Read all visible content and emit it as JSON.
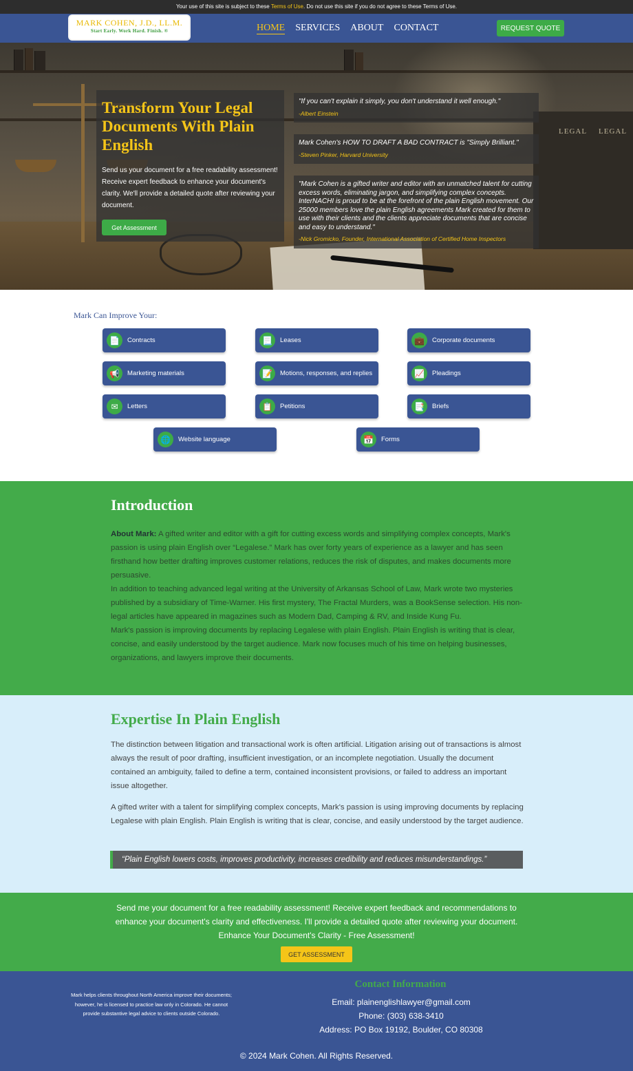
{
  "notice": {
    "before": "Your use of this site is subject to these ",
    "link": "Terms of Use",
    "after": ". Do not use this site if you do not agree to these Terms of Use."
  },
  "nav": {
    "logo_main": "MARK COHEN, J.D., LL.M.",
    "logo_tagline": "Start Early. Work Hard. Finish. ®",
    "links": [
      "HOME",
      "SERVICES",
      "ABOUT",
      "CONTACT"
    ],
    "active": "HOME",
    "quote_button": "REQUEST QUOTE"
  },
  "hero": {
    "title": "Transform Your Legal Documents With Plain English",
    "text": "Send us your document for a free readability assessment! Receive expert feedback to enhance your document's clarity. We'll provide a detailed quote after reviewing your document.",
    "button": "Get Assessment",
    "book_label": "LEGAL",
    "quotes": [
      {
        "text": "\"If you can't explain it simply, you don't understand it well enough.\"",
        "author": "-Albert Einstein"
      },
      {
        "text": "Mark Cohen's HOW TO DRAFT A BAD CONTRACT is \"Simply Brilliant.\"",
        "author": "-Steven Pinker, Harvard University"
      },
      {
        "text": "\"Mark Cohen is a gifted writer and editor with an unmatched talent for cutting excess words, eliminating jargon, and simplifying complex concepts. InterNACHI is proud to be at the forefront of the plain English movement. Our 25000 members love the plain English agreements Mark created for them to use with their clients and the clients appreciate documents that are concise and easy to understand.\"",
        "author": "-Nick Gromicko, Founder, International Association of Certified Home Inspectors"
      }
    ]
  },
  "services": {
    "title": "Mark Can Improve Your:",
    "items": [
      {
        "label": "Contracts",
        "icon": "document-icon",
        "glyph": "📄"
      },
      {
        "label": "Leases",
        "icon": "lease-icon",
        "glyph": "📃"
      },
      {
        "label": "Corporate documents",
        "icon": "briefcase-icon",
        "glyph": "💼"
      },
      {
        "label": "Marketing materials",
        "icon": "megaphone-icon",
        "glyph": "📢"
      },
      {
        "label": "Motions, responses, and replies",
        "icon": "memo-icon",
        "glyph": "📝"
      },
      {
        "label": "Pleadings",
        "icon": "chart-icon",
        "glyph": "📈"
      },
      {
        "label": "Letters",
        "icon": "envelope-icon",
        "glyph": "✉"
      },
      {
        "label": "Petitions",
        "icon": "petition-icon",
        "glyph": "📋"
      },
      {
        "label": "Briefs",
        "icon": "brief-icon",
        "glyph": "📑"
      },
      {
        "label": "Website language",
        "icon": "globe-icon",
        "glyph": "🌐"
      },
      {
        "label": "Forms",
        "icon": "calendar-icon",
        "glyph": "📅"
      }
    ]
  },
  "intro": {
    "title": "Introduction",
    "lead": "About Mark:",
    "p1": " A gifted writer and editor with a gift for cutting excess words and simplifying complex concepts, Mark's passion is using plain English over “Legalese.” Mark has over forty years of experience as a lawyer and has seen firsthand how better drafting improves customer relations, reduces the risk of disputes, and makes documents more persuasive.",
    "p2": "In addition to teaching advanced legal writing at the University of Arkansas School of Law, Mark wrote two mysteries published by a subsidiary of Time-Warner. His first mystery, The Fractal Murders, was a BookSense selection. His non-legal articles have appeared in magazines such as Modern Dad, Camping & RV, and Inside Kung Fu.",
    "p3": "Mark's passion is improving documents by replacing Legalese with plain English. Plain English is writing that is clear, concise, and easily understood by the target audience. Mark now focuses much of his time on helping businesses, organizations, and lawyers improve their documents."
  },
  "expertise": {
    "title": "Expertise In Plain English",
    "p1": "The distinction between litigation and transactional work is often artificial. Litigation arising out of transactions is almost always the result of poor drafting, insufficient investigation, or an incomplete negotiation. Usually the document contained an ambiguity, failed to define a term, contained inconsistent provisions, or failed to address an important issue altogether.",
    "p2": "A gifted writer with a talent for simplifying complex concepts, Mark's passion is using improving documents by replacing Legalese with plain English. Plain English is writing that is clear, concise, and easily understood by the target audience.",
    "quote": "“Plain English lowers costs, improves productivity, increases credibility and reduces misunderstandings.”"
  },
  "cta": {
    "text": "Send me your document for a free readability assessment! Receive expert feedback and recommendations to enhance your document's clarity and effectiveness. I'll provide a detailed quote after reviewing your document.",
    "subtext": "Enhance Your Document's Clarity - Free Assessment!",
    "button": "GET ASSESSMENT"
  },
  "footer": {
    "note": "Mark helps clients throughout North America improve their documents; however, he is licensed to practice law only in Colorado. He cannot provide substantive legal advice to clients outside Colorado.",
    "contact_title": "Contact Information",
    "email": "Email: plainenglishlawyer@gmail.com",
    "phone": "Phone: (303) 638-3410",
    "address": "Address: PO Box 19192, Boulder, CO 80308",
    "copyright": "© 2024 Mark Cohen. All Rights Reserved."
  },
  "colors": {
    "nav_blue": "#3a5594",
    "accent_green": "#43ab4a",
    "accent_gold": "#f5c518",
    "light_blue_bg": "#d8eefa"
  }
}
